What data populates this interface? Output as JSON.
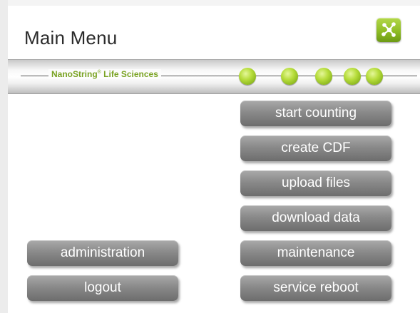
{
  "header": {
    "title": "Main Menu"
  },
  "banner": {
    "brand": "NanoString",
    "brand_mark": "®",
    "brand_suffix": " Life Sciences",
    "dot_count": 5,
    "accent_color": "#8fbd26"
  },
  "menu": {
    "start_counting": "start counting",
    "create_cdf": "create CDF",
    "upload_files": "upload files",
    "download_data": "download data",
    "maintenance": "maintenance",
    "service_reboot": "service reboot",
    "administration": "administration",
    "logout": "logout"
  },
  "icons": {
    "logo": "network-nodes-icon"
  },
  "colors": {
    "button_gray": "#8a8a8a",
    "accent_green": "#8fbd26"
  }
}
